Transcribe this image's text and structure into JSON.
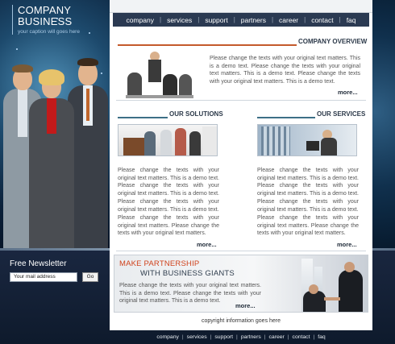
{
  "logo": {
    "line1": "COMPANY",
    "line2": "BUSINESS",
    "caption": "your caption will goes here"
  },
  "nav": {
    "items": [
      "company",
      "services",
      "support",
      "partners",
      "career",
      "contact",
      "faq"
    ]
  },
  "overview": {
    "title": "COMPANY OVERVIEW",
    "text": "Please change the texts with your original text matters. This is a demo text. Please change the texts with your original text matters. This is a demo text. Please change the texts with your original text matters. This is a demo text.",
    "more": "more..."
  },
  "solutions": {
    "title": "OUR SOLUTIONS",
    "text1": "Please change the texts with your original text matters. This is a demo text. Please change the texts with your original text matters. This is a demo text. Please change the texts with your original text matters. This is a demo text.",
    "text2": "Please change the texts with your original text matters. Please change the texts with your original text matters.",
    "more": "more..."
  },
  "services": {
    "title": "OUR SERVICES",
    "text1": "Please change the texts with your original text matters. This is a demo text. Please change the texts with your original text matters. This is a demo text. Please change the texts with your original text matters. This is a demo text.",
    "text2": "Please change the texts with your original text matters. Please change the texts with your original text matters.",
    "more": "more..."
  },
  "partnership": {
    "line1": "MAKE PARTNERSHIP",
    "line2": "WITH BUSINESS GIANTS",
    "text": "Please change the texts with your original text matters. This is a demo text. Please change the texts with your original text matters. This is a demo text.",
    "more": "more..."
  },
  "copyright": "copyright information goes here",
  "newsletter": {
    "title": "Free Newsletter",
    "input_value": "Your mail address",
    "button": "Go"
  },
  "footer": {
    "items": [
      "company",
      "services",
      "support",
      "partners",
      "career",
      "contact",
      "faq"
    ]
  },
  "colors": {
    "accent_orange": "#d0431d",
    "nav_bg": "#2b3a52",
    "overview_line": "#c45a2c",
    "section_line": "#3d6f86"
  }
}
